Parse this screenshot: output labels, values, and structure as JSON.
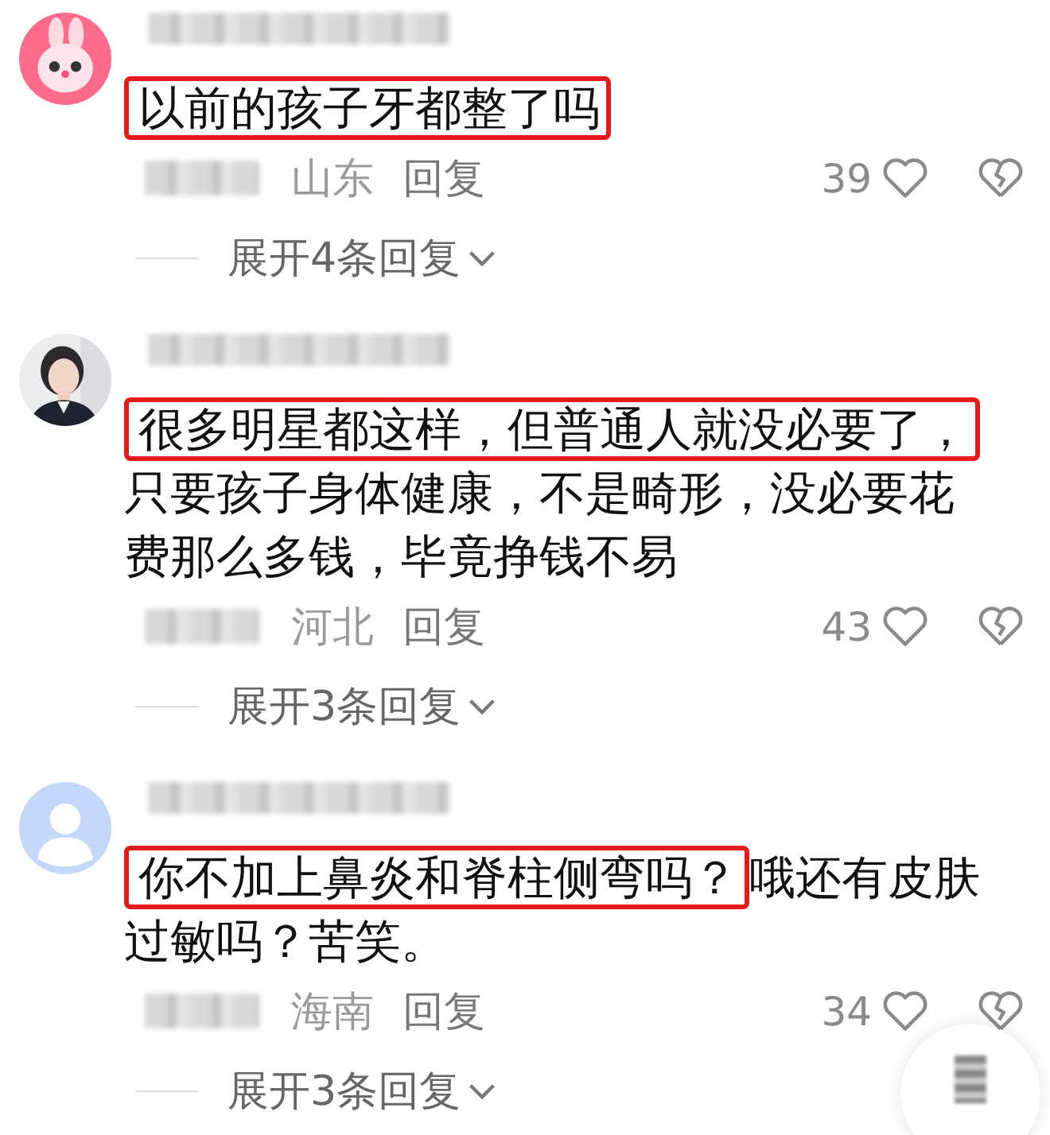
{
  "comments": [
    {
      "avatar": {
        "kind": "cartoon"
      },
      "text_highlighted": "以前的孩子牙都整了吗",
      "region": "山东",
      "reply": "回复",
      "likes": "39",
      "expand": "展开4条回复"
    },
    {
      "text_highlighted": "很多明星都这样，但普通人就没必要了，",
      "text_rest": "只要孩子身体健康，不是畸形，没必要花费那么多钱，毕竟挣钱不易",
      "region": "河北",
      "reply": "回复",
      "likes": "43",
      "expand": "展开3条回复"
    },
    {
      "avatar": {
        "kind": "default"
      },
      "text_highlighted": "你不加上鼻炎和脊柱侧弯吗？",
      "text_rest": "哦还有皮肤过敏吗？苦笑。",
      "region": "海南",
      "reply": "回复",
      "likes": "34",
      "expand": "展开3条回复"
    }
  ]
}
